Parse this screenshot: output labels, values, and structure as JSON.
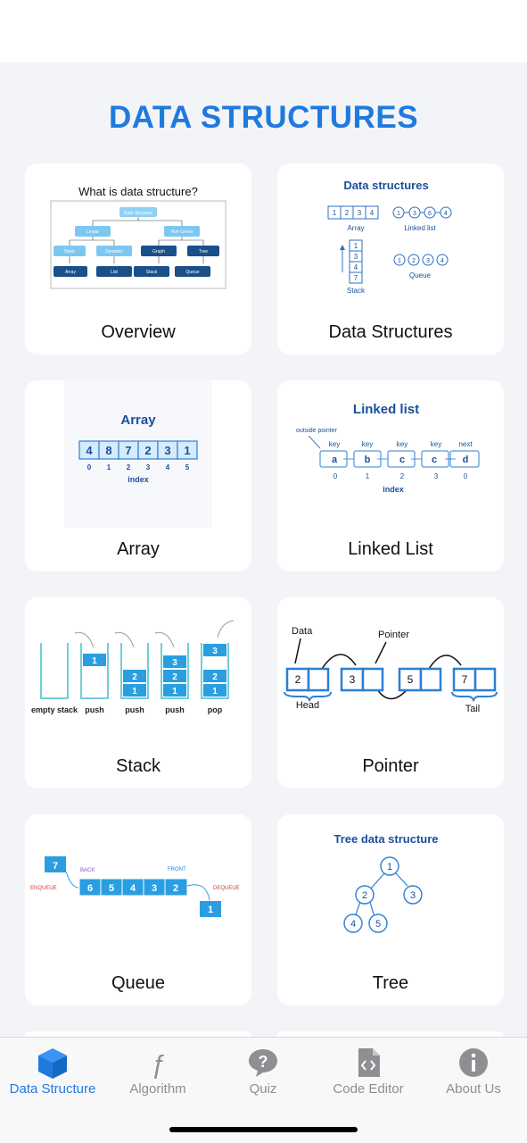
{
  "page": {
    "title": "DATA STRUCTURES"
  },
  "cards": [
    {
      "label": "Overview",
      "thumb": {
        "title": "What is data structure?",
        "root": "Data Structure",
        "linear": "Linear",
        "nonlinear": "Non-Linear",
        "static": "Static",
        "dynamic": "Dynamic",
        "graph": "Graph",
        "tree": "Tree",
        "array": "Array",
        "list": "List",
        "stack": "Stack",
        "queue": "Queue"
      }
    },
    {
      "label": "Data Structures",
      "thumb": {
        "title": "Data structures",
        "array_cells": [
          "1",
          "2",
          "3",
          "4"
        ],
        "array_label": "Array",
        "list_nodes": [
          "1",
          "3",
          "6",
          "4"
        ],
        "list_label": "Linked list",
        "stack_cells": [
          "1",
          "3",
          "4",
          "7"
        ],
        "stack_label": "Stack",
        "queue_nodes": [
          "1",
          "2",
          "3",
          "4"
        ],
        "queue_label": "Queue"
      }
    },
    {
      "label": "Array",
      "thumb": {
        "title": "Array",
        "cells": [
          "4",
          "8",
          "7",
          "2",
          "3",
          "1"
        ],
        "indices": [
          "0",
          "1",
          "2",
          "3",
          "4",
          "5"
        ],
        "index_label": "index"
      }
    },
    {
      "label": "Linked List",
      "thumb": {
        "title": "Linked list",
        "pointer_label": "outside pointer",
        "headers": [
          "key",
          "key",
          "key",
          "key",
          "next"
        ],
        "values": [
          "a",
          "b",
          "c",
          "c",
          "d"
        ],
        "indices": [
          "0",
          "1",
          "2",
          "3",
          "0"
        ],
        "index_label": "index"
      }
    },
    {
      "label": "Stack",
      "thumb": {
        "captions": [
          "empty stack",
          "push",
          "push",
          "push",
          "pop"
        ],
        "s2": [
          "1"
        ],
        "s3": [
          "2",
          "1"
        ],
        "s4": [
          "3",
          "2",
          "1"
        ],
        "s5": [
          "2",
          "1"
        ],
        "popped": "3"
      }
    },
    {
      "label": "Pointer",
      "thumb": {
        "data_label": "Data",
        "pointer_label": "Pointer",
        "head_label": "Head",
        "tail_label": "Tail",
        "nodes": [
          "2",
          "3",
          "5",
          "7"
        ]
      }
    },
    {
      "label": "Queue",
      "thumb": {
        "incoming": "7",
        "back_label": "BACK",
        "front_label": "FRONT",
        "enqueue_label": "ENQUEUE",
        "dequeue_label": "DEQUEUE",
        "cells": [
          "6",
          "5",
          "4",
          "3",
          "2"
        ],
        "outgoing": "1"
      }
    },
    {
      "label": "Tree",
      "thumb": {
        "title": "Tree data structure",
        "nodes": [
          "1",
          "2",
          "3",
          "4",
          "5"
        ]
      }
    }
  ],
  "tabbar": {
    "tabs": [
      {
        "label": "Data Structure",
        "icon": "cube-icon",
        "active": true
      },
      {
        "label": "Algorithm",
        "icon": "function-icon",
        "active": false
      },
      {
        "label": "Quiz",
        "icon": "question-bubble-icon",
        "active": false
      },
      {
        "label": "Code Editor",
        "icon": "code-file-icon",
        "active": false
      },
      {
        "label": "About Us",
        "icon": "info-icon",
        "active": false
      }
    ]
  },
  "colors": {
    "accent": "#1f7ae0",
    "inactive": "#8e8e93",
    "diagram_blue": "#2b7fd4",
    "navy": "#123c7a"
  }
}
